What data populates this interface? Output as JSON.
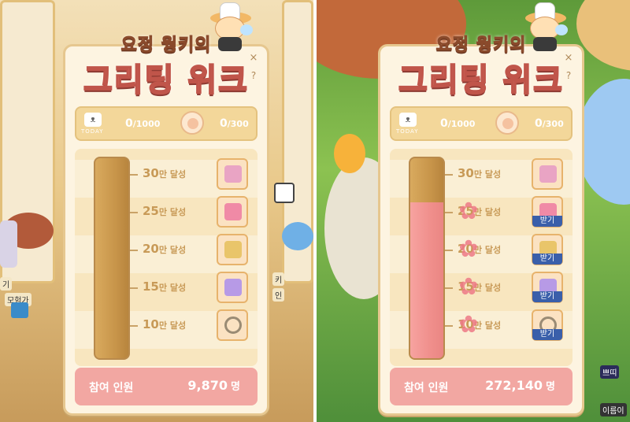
{
  "event": {
    "title_top": "요정 웡키의",
    "title_main": "그리팅 위크",
    "close_icon": "×",
    "help_icon": "?"
  },
  "today": {
    "label": "TODAY",
    "icon": "cat-face-icon"
  },
  "panels": [
    {
      "today_count": "0",
      "today_total": "/1000",
      "avatar_count": "0",
      "avatar_total": "/300",
      "participants_label": "참여 인원",
      "participants_value": "9,870",
      "participants_unit": "명",
      "progress_fraction": 0.0,
      "milestones": [
        {
          "num": "30",
          "unit": "만 달성",
          "reward_icon": "weapon-box-icon",
          "claim": "",
          "achieved": false
        },
        {
          "num": "25",
          "unit": "만 달성",
          "reward_icon": "coupon-icon",
          "claim": "",
          "achieved": false
        },
        {
          "num": "20",
          "unit": "만 달성",
          "reward_icon": "chair-icon",
          "claim": "",
          "achieved": false
        },
        {
          "num": "15",
          "unit": "만 달성",
          "reward_icon": "gift-box-icon",
          "claim": "",
          "achieved": false
        },
        {
          "num": "10",
          "unit": "만 달성",
          "reward_icon": "ring-icon",
          "claim": "",
          "achieved": false
        }
      ]
    },
    {
      "today_count": "0",
      "today_total": "/1000",
      "avatar_count": "0",
      "avatar_total": "/300",
      "participants_label": "참여 인원",
      "participants_value": "272,140",
      "participants_unit": "명",
      "progress_fraction": 0.78,
      "milestones": [
        {
          "num": "30",
          "unit": "만 달성",
          "reward_icon": "weapon-box-icon",
          "claim": "",
          "achieved": false
        },
        {
          "num": "25",
          "unit": "만 달성",
          "reward_icon": "coupon-icon",
          "claim": "받기",
          "achieved": true
        },
        {
          "num": "20",
          "unit": "만 달성",
          "reward_icon": "chair-icon",
          "claim": "받기",
          "achieved": true
        },
        {
          "num": "15",
          "unit": "만 달성",
          "reward_icon": "gift-box-icon",
          "claim": "받기",
          "achieved": true
        },
        {
          "num": "10",
          "unit": "만 달성",
          "reward_icon": "ring-icon",
          "claim": "받기",
          "achieved": true
        }
      ]
    }
  ],
  "scene": {
    "left_tags": [
      "기",
      "모험가",
      "키",
      "인"
    ],
    "right_tags": [
      "쁘띠",
      "이름이"
    ]
  },
  "colors": {
    "panel_bg": "#fdf4e1",
    "tube_empty": "#c8954a",
    "tube_fill": "#f08f8c",
    "footer_bg": "#f2a7a2",
    "milestone_text": "#c89a57",
    "claim_button": "#3a5faa"
  }
}
